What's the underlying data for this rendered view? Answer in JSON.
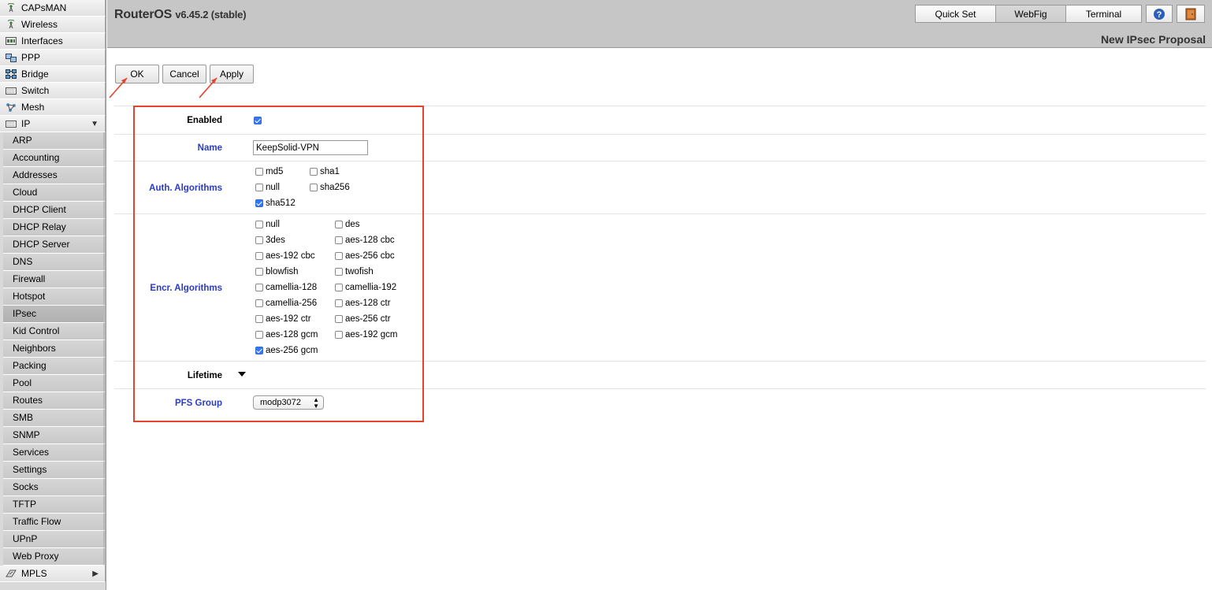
{
  "sidebar": {
    "items": [
      {
        "label": "CAPsMAN",
        "icon": "antenna-icon"
      },
      {
        "label": "Wireless",
        "icon": "antenna-icon"
      },
      {
        "label": "Interfaces",
        "icon": "interfaces-icon"
      },
      {
        "label": "PPP",
        "icon": "ppp-icon"
      },
      {
        "label": "Bridge",
        "icon": "bridge-icon"
      },
      {
        "label": "Switch",
        "icon": "switch-icon"
      },
      {
        "label": "Mesh",
        "icon": "mesh-icon"
      },
      {
        "label": "IP",
        "icon": "ip-icon",
        "expanded": true
      }
    ],
    "ip_submenu": [
      "ARP",
      "Accounting",
      "Addresses",
      "Cloud",
      "DHCP Client",
      "DHCP Relay",
      "DHCP Server",
      "DNS",
      "Firewall",
      "Hotspot",
      "IPsec",
      "Kid Control",
      "Neighbors",
      "Packing",
      "Pool",
      "Routes",
      "SMB",
      "SNMP",
      "Services",
      "Settings",
      "Socks",
      "TFTP",
      "Traffic Flow",
      "UPnP",
      "Web Proxy"
    ],
    "active_submenu": "IPsec",
    "bottom_item": {
      "label": "MPLS",
      "icon": "mpls-icon"
    }
  },
  "header": {
    "brand": "RouterOS",
    "version": "v6.45.2 (stable)",
    "buttons": {
      "quick_set": "Quick Set",
      "webfig": "WebFig",
      "terminal": "Terminal"
    },
    "active_mode": "WebFig",
    "form_title": "New IPsec Proposal"
  },
  "actions": {
    "ok": "OK",
    "cancel": "Cancel",
    "apply": "Apply"
  },
  "form": {
    "enabled": {
      "label": "Enabled",
      "checked": true
    },
    "name": {
      "label": "Name",
      "value": "KeepSolid-VPN"
    },
    "auth": {
      "label": "Auth. Algorithms",
      "options": [
        {
          "label": "md5",
          "checked": false
        },
        {
          "label": "sha1",
          "checked": false
        },
        {
          "label": "null",
          "checked": false
        },
        {
          "label": "sha256",
          "checked": false
        },
        {
          "label": "sha512",
          "checked": true
        }
      ]
    },
    "encr": {
      "label": "Encr. Algorithms",
      "options": [
        {
          "label": "null",
          "checked": false
        },
        {
          "label": "des",
          "checked": false
        },
        {
          "label": "3des",
          "checked": false
        },
        {
          "label": "aes-128 cbc",
          "checked": false
        },
        {
          "label": "aes-192 cbc",
          "checked": false
        },
        {
          "label": "aes-256 cbc",
          "checked": false
        },
        {
          "label": "blowfish",
          "checked": false
        },
        {
          "label": "twofish",
          "checked": false
        },
        {
          "label": "camellia-128",
          "checked": false
        },
        {
          "label": "camellia-192",
          "checked": false
        },
        {
          "label": "camellia-256",
          "checked": false
        },
        {
          "label": "aes-128 ctr",
          "checked": false
        },
        {
          "label": "aes-192 ctr",
          "checked": false
        },
        {
          "label": "aes-256 ctr",
          "checked": false
        },
        {
          "label": "aes-128 gcm",
          "checked": false
        },
        {
          "label": "aes-192 gcm",
          "checked": false
        },
        {
          "label": "aes-256 gcm",
          "checked": true
        }
      ]
    },
    "lifetime": {
      "label": "Lifetime"
    },
    "pfs_group": {
      "label": "PFS Group",
      "value": "modp3072"
    }
  },
  "colors": {
    "highlight": "#e8412c",
    "label_blue": "#2a3bc4",
    "checkbox_checked": "#3478f6"
  }
}
